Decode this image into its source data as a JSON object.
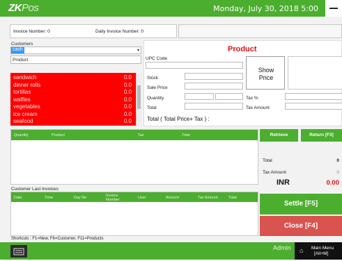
{
  "app": {
    "logo_main": "ZK",
    "logo_sub": "Pos",
    "datetime": "Monday, July 30, 2018 5:00"
  },
  "info": {
    "invoice_number": "Invoice Number: 0",
    "daily_invoice_number": "Daily Invoice Number: 0"
  },
  "customers": {
    "label": "Customers",
    "selected": "cash",
    "product_label": "Product"
  },
  "product_list": [
    {
      "name": "sandwich",
      "price": "0.0"
    },
    {
      "name": "dinner rolls",
      "price": "0.0"
    },
    {
      "name": "tortillas",
      "price": "0.0"
    },
    {
      "name": "waffles",
      "price": "0.0"
    },
    {
      "name": "vegetables",
      "price": "0.0"
    },
    {
      "name": "ice cream",
      "price": "0.0"
    },
    {
      "name": "seafood",
      "price": "0.0"
    }
  ],
  "product_panel": {
    "title": "Product",
    "upc_label": "UPC Code",
    "show_price": "Show Price",
    "stock": "Stock",
    "sale_price": "Sale Price",
    "quantity": "Quantity",
    "tax_pct": "Tax %",
    "total": "Total",
    "tax_amount": "Tax Amount",
    "grand_total": "Total ( Total Price+ Tax ) :"
  },
  "cart_grid": {
    "headers": [
      "Quantity",
      "Product",
      "Tax",
      "Total"
    ]
  },
  "actions": {
    "retrieve": "Retrieve",
    "return": "Return [F3]",
    "settle": "Settle [F5]",
    "close": "Close [F4]"
  },
  "summary": {
    "total_label": "Total",
    "total_value": "0",
    "tax_label": "Tax Amount",
    "tax_value": "0",
    "currency": "INR",
    "amount": "0.00"
  },
  "last_invoices": {
    "label": "Customer Last Invoices",
    "headers": [
      "Date",
      "Time",
      "Day No",
      "Invoice Number",
      "User",
      "Amount",
      "Tax Amount",
      "Total"
    ]
  },
  "shortcuts": "Shortcuts : F1=New, F6=Customer, F11=Products",
  "bottom": {
    "user": "Admin",
    "menu": "Main Menu",
    "menu_key": "[Alt+M]"
  },
  "colors": {
    "brand": "#4cae2f",
    "list_bg": "#ff0000",
    "accent_red": "#e01010",
    "close_btn": "#d9534f"
  }
}
